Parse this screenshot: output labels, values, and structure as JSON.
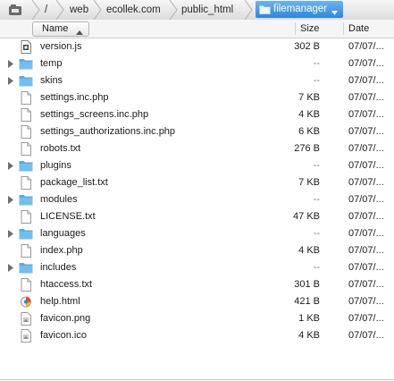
{
  "breadcrumb": {
    "items": [
      "/",
      "web",
      "ecollek.com",
      "public_html"
    ],
    "active": "filemanager"
  },
  "columns": {
    "name": "Name",
    "size": "Size",
    "date": "Date"
  },
  "files": [
    {
      "name": "version.js",
      "type": "js",
      "size": "302 B",
      "date": "07/07/..."
    },
    {
      "name": "temp",
      "type": "folder",
      "size": "--",
      "date": "07/07/..."
    },
    {
      "name": "skins",
      "type": "folder",
      "size": "--",
      "date": "07/07/..."
    },
    {
      "name": "settings.inc.php",
      "type": "file",
      "size": "7 KB",
      "date": "07/07/..."
    },
    {
      "name": "settings_screens.inc.php",
      "type": "file",
      "size": "4 KB",
      "date": "07/07/..."
    },
    {
      "name": "settings_authorizations.inc.php",
      "type": "file",
      "size": "6 KB",
      "date": "07/07/..."
    },
    {
      "name": "robots.txt",
      "type": "file",
      "size": "276 B",
      "date": "07/07/..."
    },
    {
      "name": "plugins",
      "type": "folder",
      "size": "--",
      "date": "07/07/..."
    },
    {
      "name": "package_list.txt",
      "type": "file",
      "size": "7 KB",
      "date": "07/07/..."
    },
    {
      "name": "modules",
      "type": "folder",
      "size": "--",
      "date": "07/07/..."
    },
    {
      "name": "LICENSE.txt",
      "type": "file",
      "size": "47 KB",
      "date": "07/07/..."
    },
    {
      "name": "languages",
      "type": "folder",
      "size": "--",
      "date": "07/07/..."
    },
    {
      "name": "index.php",
      "type": "file",
      "size": "4 KB",
      "date": "07/07/..."
    },
    {
      "name": "includes",
      "type": "folder",
      "size": "--",
      "date": "07/07/..."
    },
    {
      "name": "htaccess.txt",
      "type": "file",
      "size": "301 B",
      "date": "07/07/..."
    },
    {
      "name": "help.html",
      "type": "html",
      "size": "421 B",
      "date": "07/07/..."
    },
    {
      "name": "favicon.png",
      "type": "image",
      "size": "1 KB",
      "date": "07/07/..."
    },
    {
      "name": "favicon.ico",
      "type": "image",
      "size": "4 KB",
      "date": "07/07/..."
    }
  ],
  "colors": {
    "folder": "#5aa9e6",
    "active_crumb": "#2d86dc"
  }
}
